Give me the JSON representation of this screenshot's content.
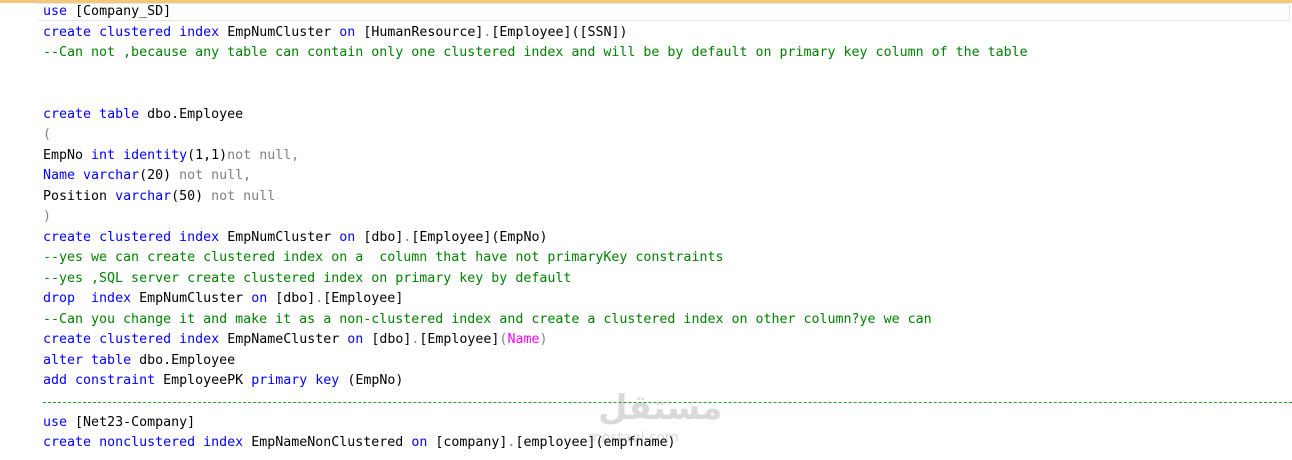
{
  "code": {
    "use_kw": "use",
    "db1": "[Company_SD]",
    "create_kw": "create",
    "clustered_kw": "clustered",
    "index_kw": "index",
    "on_kw": "on",
    "idx1_name": "EmpNumCluster",
    "idx1_target": "[HumanResource]",
    "dot": ".",
    "idx1_table": "[Employee]",
    "idx1_col": "([SSN])",
    "comment1": "--Can not ,because any table can contain only one clustered index and will be by default on primary key column of the table",
    "table_kw": "table",
    "table_name": "dbo.Employee",
    "open_paren": "(",
    "col1_name": "EmpNo",
    "int_kw": "int",
    "identity_fn": "identity",
    "identity_args": "(1,1)",
    "notnull_comma": "not null,",
    "notnull_plain": "not null",
    "col2_name": "Name",
    "varchar_kw": "varchar",
    "col2_len": "(20)",
    "col3_name": "Position",
    "col3_len": "(50)",
    "close_paren": ")",
    "dbo_schema": "[dbo]",
    "emp_table": "[Employee]",
    "empno_arg": "(EmpNo)",
    "comment2": "--yes we can create clustered index on a  column that have not primaryKey constraints",
    "comment3": "--yes ,SQL server create clustered index on primary key by default",
    "drop_kw": "drop",
    "drop_gap": "  ",
    "comment4": "--Can you change it and make it as a non-clustered index and create a clustered index on other column?ye we can",
    "idx2_name": "EmpNameCluster",
    "name_arg_open": "(",
    "name_arg": "Name",
    "name_arg_close": ")",
    "alter_kw": "alter",
    "add_kw": "add",
    "constraint_kw": "constraint",
    "pk_name": "EmployeePK",
    "primary_kw": "primary",
    "key_kw": "key",
    "db2": "[Net23-Company]",
    "nonclustered_kw": "nonclustered",
    "idx3_name": "EmpNameNonClustered",
    "company_schema": "[company]",
    "employee_tbl": "[employee]",
    "empfname_arg": "(empfname)"
  },
  "watermark": {
    "main": "مستقل",
    "sub": "mostaql.com"
  },
  "colors": {
    "keyword": "#0000ff",
    "comment": "#008000",
    "gray": "#808080",
    "function": "#ff00ff"
  }
}
